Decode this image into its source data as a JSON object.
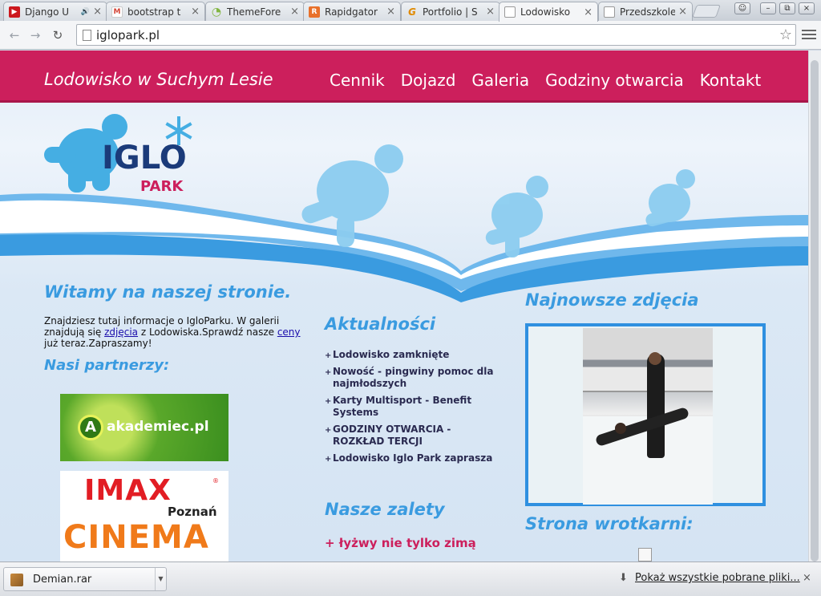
{
  "browser": {
    "tabs": [
      {
        "label": "Django U",
        "favicon_color": "#cc181e",
        "favicon": "▶",
        "audio": "🔊"
      },
      {
        "label": "bootstrap t",
        "favicon_color": "#d44638",
        "favicon": "M"
      },
      {
        "label": "ThemeFore",
        "favicon_color": "#82b541",
        "favicon": "◔"
      },
      {
        "label": "Rapidgator",
        "favicon_color": "#e8702a",
        "favicon": "R"
      },
      {
        "label": "Portfolio | S",
        "favicon_color": "#f39c12",
        "favicon": "G"
      },
      {
        "label": "Lodowisko",
        "favicon_color": "#ffffff",
        "favicon": ""
      },
      {
        "label": "Przedszkole",
        "favicon_color": "#ffffff",
        "favicon": ""
      }
    ],
    "close_glyph": "×",
    "url": "iglopark.pl",
    "back": "←",
    "forward": "→",
    "reload": "↻",
    "star": "☆"
  },
  "site": {
    "title": "Lodowisko w Suchym Lesie",
    "nav": [
      "Cennik",
      "Dojazd",
      "Galeria",
      "Godziny otwarcia",
      "Kontakt"
    ],
    "logo_text_top": "IGLO",
    "logo_text_bottom": "PARK",
    "welcome_heading": "Witamy na naszej stronie.",
    "intro_part1": "Znajdziesz tutaj informacje o IgloParku. W galerii znajdują się ",
    "intro_link1": "zdjęcia",
    "intro_part2": " z Lodowiska.Sprawdź nasze ",
    "intro_link2": "ceny",
    "intro_part3": " już teraz.Zapraszamy!",
    "partners_heading": "Nasi partnerzy:",
    "partner1": {
      "badge": "A",
      "text": "akademiec.pl"
    },
    "partner2": {
      "word": "IMAX",
      "reg": "®",
      "city": "Poznań",
      "cinema": "CINEMA"
    },
    "news_heading": "Aktualności",
    "news": [
      "Lodowisko zamknięte",
      "Nowość - pingwiny pomoc dla najmłodszych",
      "Karty Multisport - Benefit Systems",
      "GODZINY OTWARCIA - ROZKŁAD TERCJI",
      "Lodowisko Iglo Park zaprasza"
    ],
    "advantages_heading": "Nasze zalety",
    "advantage_item": "+ łyżwy nie tylko zimą",
    "photos_heading": "Najnowsze zdjęcia",
    "wrotkarnia_heading": "Strona wrotkarni:"
  },
  "downloads": {
    "file": "Demian.rar",
    "show_all": "Pokaż wszystkie pobrane pliki...",
    "close": "×"
  },
  "colors": {
    "brand_pink": "#cc1f5c",
    "heading_blue": "#3a9be0"
  }
}
